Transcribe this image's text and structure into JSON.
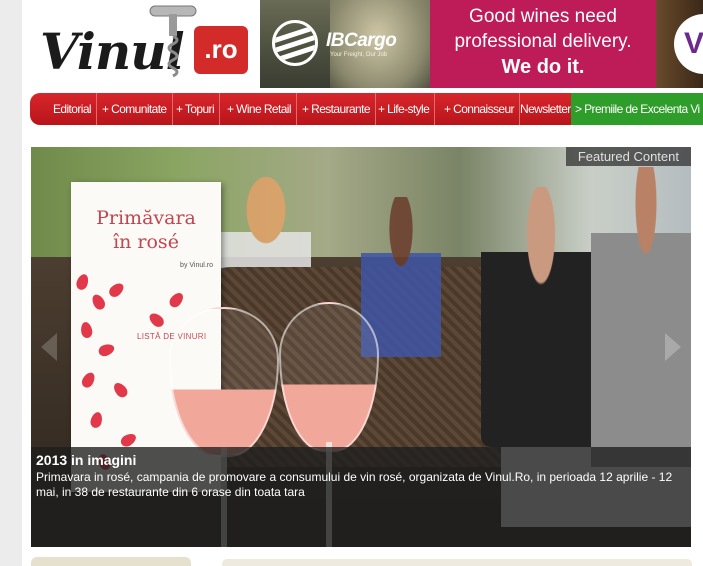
{
  "header": {
    "logo": {
      "text": "Vinul",
      "suffix": ".ro"
    },
    "ads": [
      {
        "brand": "IBCargo",
        "tagline": "Your Freight, Our Job"
      },
      {
        "line1": "Good wines need",
        "line2": "professional delivery.",
        "line3": "We do it.",
        "color": "#be1b59"
      },
      {
        "partial_mark": "V"
      }
    ]
  },
  "nav": {
    "items": [
      {
        "label": "Editorial"
      },
      {
        "label": "+ Comunitate"
      },
      {
        "label": "+ Topuri"
      },
      {
        "label": "+ Wine Retail"
      },
      {
        "label": "+ Restaurante"
      },
      {
        "label": "+ Life-style"
      },
      {
        "label": "+ Connaisseur"
      },
      {
        "label": "Newsletter"
      },
      {
        "label": "> Premiile de Excelenta Vi"
      }
    ],
    "accent": "#d7262c",
    "highlight": "#2f9d2a"
  },
  "featured": {
    "label": "Featured Content",
    "menu_card": {
      "title_line1": "Primăvara",
      "title_line2": "în rosé",
      "by": "by Vinul.ro",
      "list": "LISTĂ DE VINURI"
    },
    "caption": {
      "title": "2013 in imagini",
      "text": "Primavara in rosé, campania de promovare a consumului de vin rosé, organizata de Vinul.Ro, in perioada 12 aprilie - 12 mai, in 38 de restaurante din 6 orase din toata tara"
    }
  }
}
